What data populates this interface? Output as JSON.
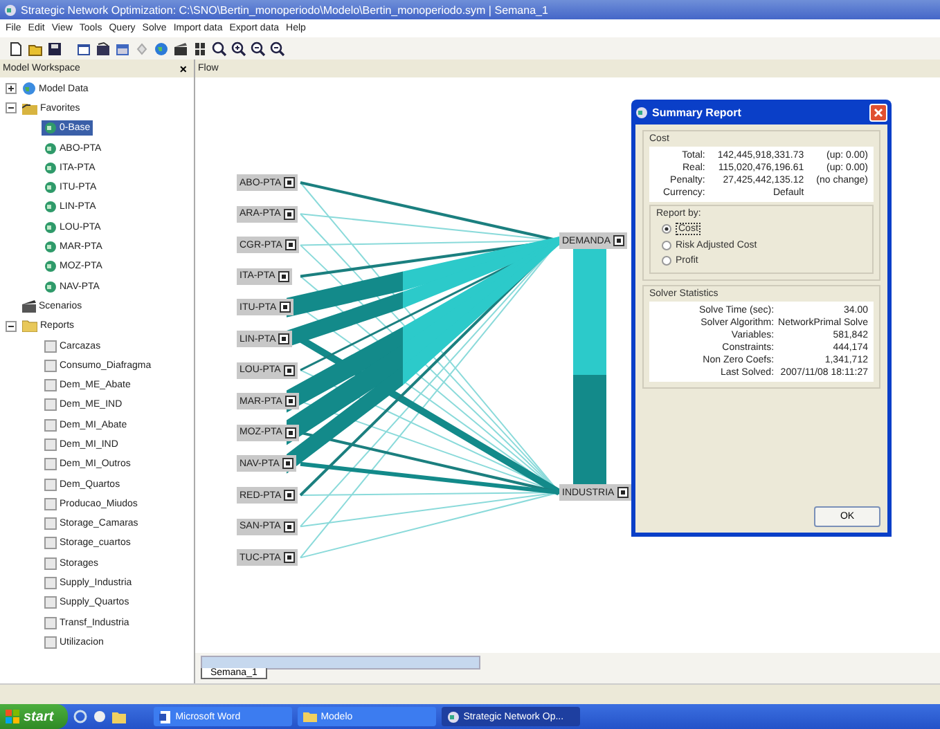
{
  "window": {
    "title": "Strategic Network Optimization:   C:\\SNO\\Bertin_monoperiodo\\Modelo\\Bertin_monoperiodo.sym  |  Semana_1"
  },
  "menu": [
    "File",
    "Edit",
    "View",
    "Tools",
    "Query",
    "Solve",
    "Import data",
    "Export data",
    "Help"
  ],
  "workspace": {
    "title": "Model Workspace",
    "close": "×",
    "tree": [
      {
        "label": "Model Data",
        "kind": "data",
        "expanded": false
      },
      {
        "label": "Favorites",
        "kind": "favorites",
        "expanded": true,
        "children": [
          {
            "label": "0-Base",
            "kind": "favorite",
            "selected": true
          },
          {
            "label": "ABO-PTA",
            "kind": "favorite",
            "selected": false
          },
          {
            "label": "ITA-PTA",
            "kind": "favorite",
            "selected": false
          },
          {
            "label": "ITU-PTA",
            "kind": "favorite",
            "selected": false
          },
          {
            "label": "LIN-PTA",
            "kind": "favorite",
            "selected": false
          },
          {
            "label": "LOU-PTA",
            "kind": "favorite",
            "selected": false
          },
          {
            "label": "MAR-PTA",
            "kind": "favorite",
            "selected": false
          },
          {
            "label": "MOZ-PTA",
            "kind": "favorite",
            "selected": false
          },
          {
            "label": "NAV-PTA",
            "kind": "favorite",
            "selected": false
          }
        ]
      },
      {
        "label": "Scenarios",
        "kind": "scenario"
      },
      {
        "label": "Reports",
        "kind": "folder",
        "expanded": true,
        "children": [
          {
            "label": "Carcazas",
            "kind": "report"
          },
          {
            "label": "Consumo_Diafragma",
            "kind": "report"
          },
          {
            "label": "Dem_ME_Abate",
            "kind": "report"
          },
          {
            "label": "Dem_ME_IND",
            "kind": "report"
          },
          {
            "label": "Dem_MI_Abate",
            "kind": "report"
          },
          {
            "label": "Dem_MI_IND",
            "kind": "report"
          },
          {
            "label": "Dem_MI_Outros",
            "kind": "report"
          },
          {
            "label": "Dem_Quartos",
            "kind": "report"
          },
          {
            "label": "Producao_Miudos",
            "kind": "report"
          },
          {
            "label": "Storage_Camaras",
            "kind": "report"
          },
          {
            "label": "Storage_cuartos",
            "kind": "report"
          },
          {
            "label": "Storages",
            "kind": "report"
          },
          {
            "label": "Supply_Industria",
            "kind": "report"
          },
          {
            "label": "Supply_Quartos",
            "kind": "report"
          },
          {
            "label": "Transf_Industria",
            "kind": "report"
          },
          {
            "label": "Utilizacion",
            "kind": "report"
          }
        ]
      }
    ]
  },
  "flow": {
    "title": "Flow",
    "sources": [
      "ABO-PTA",
      "ARA-PTA",
      "CGR-PTA",
      "ITA-PTA",
      "ITU-PTA",
      "LIN-PTA",
      "LOU-PTA",
      "MAR-PTA",
      "MOZ-PTA",
      "NAV-PTA",
      "RED-PTA",
      "SAN-PTA",
      "TUC-PTA"
    ],
    "sinks": [
      "DEMANDA",
      "INDUSTRIA"
    ],
    "tabs": [
      {
        "label": "Semana_1",
        "selected": true
      }
    ]
  },
  "summary": {
    "title": "Summary Report",
    "cost": {
      "title": "Cost",
      "rows": [
        {
          "label": "Total:",
          "value": "142,445,918,331.73",
          "note": "(up: 0.00)"
        },
        {
          "label": "Real:",
          "value": "115,020,476,196.61",
          "note": "(up: 0.00)"
        },
        {
          "label": "Penalty:",
          "value": "27,425,442,135.12",
          "note": "(no change)"
        },
        {
          "label": "Currency:",
          "value": "Default"
        }
      ]
    },
    "report_by": {
      "title": "Report by:",
      "options": [
        {
          "label": "Cost",
          "selected": true
        },
        {
          "label": "Risk Adjusted Cost",
          "selected": false
        },
        {
          "label": "Profit",
          "selected": false
        }
      ]
    },
    "solver": {
      "title": "Solver Statistics",
      "rows": [
        {
          "label": "Solve Time (sec):",
          "value": "34.00"
        },
        {
          "label": "Solver Algorithm:",
          "value": "NetworkPrimal Solve"
        },
        {
          "label": "Variables:",
          "value": "581,842"
        },
        {
          "label": "Constraints:",
          "value": "444,174"
        },
        {
          "label": "Non Zero Coefs:",
          "value": "1,341,712"
        },
        {
          "label": "Last Solved:",
          "value": "2007/11/08 18:11:27"
        }
      ]
    },
    "ok": "OK"
  },
  "taskbar": {
    "start": "start",
    "tasks": [
      {
        "label": "Microsoft Word",
        "kind": "word",
        "selected": false
      },
      {
        "label": "Modelo",
        "kind": "folder",
        "selected": false
      },
      {
        "label": "Strategic Network Op...",
        "kind": "app",
        "selected": true
      }
    ]
  }
}
